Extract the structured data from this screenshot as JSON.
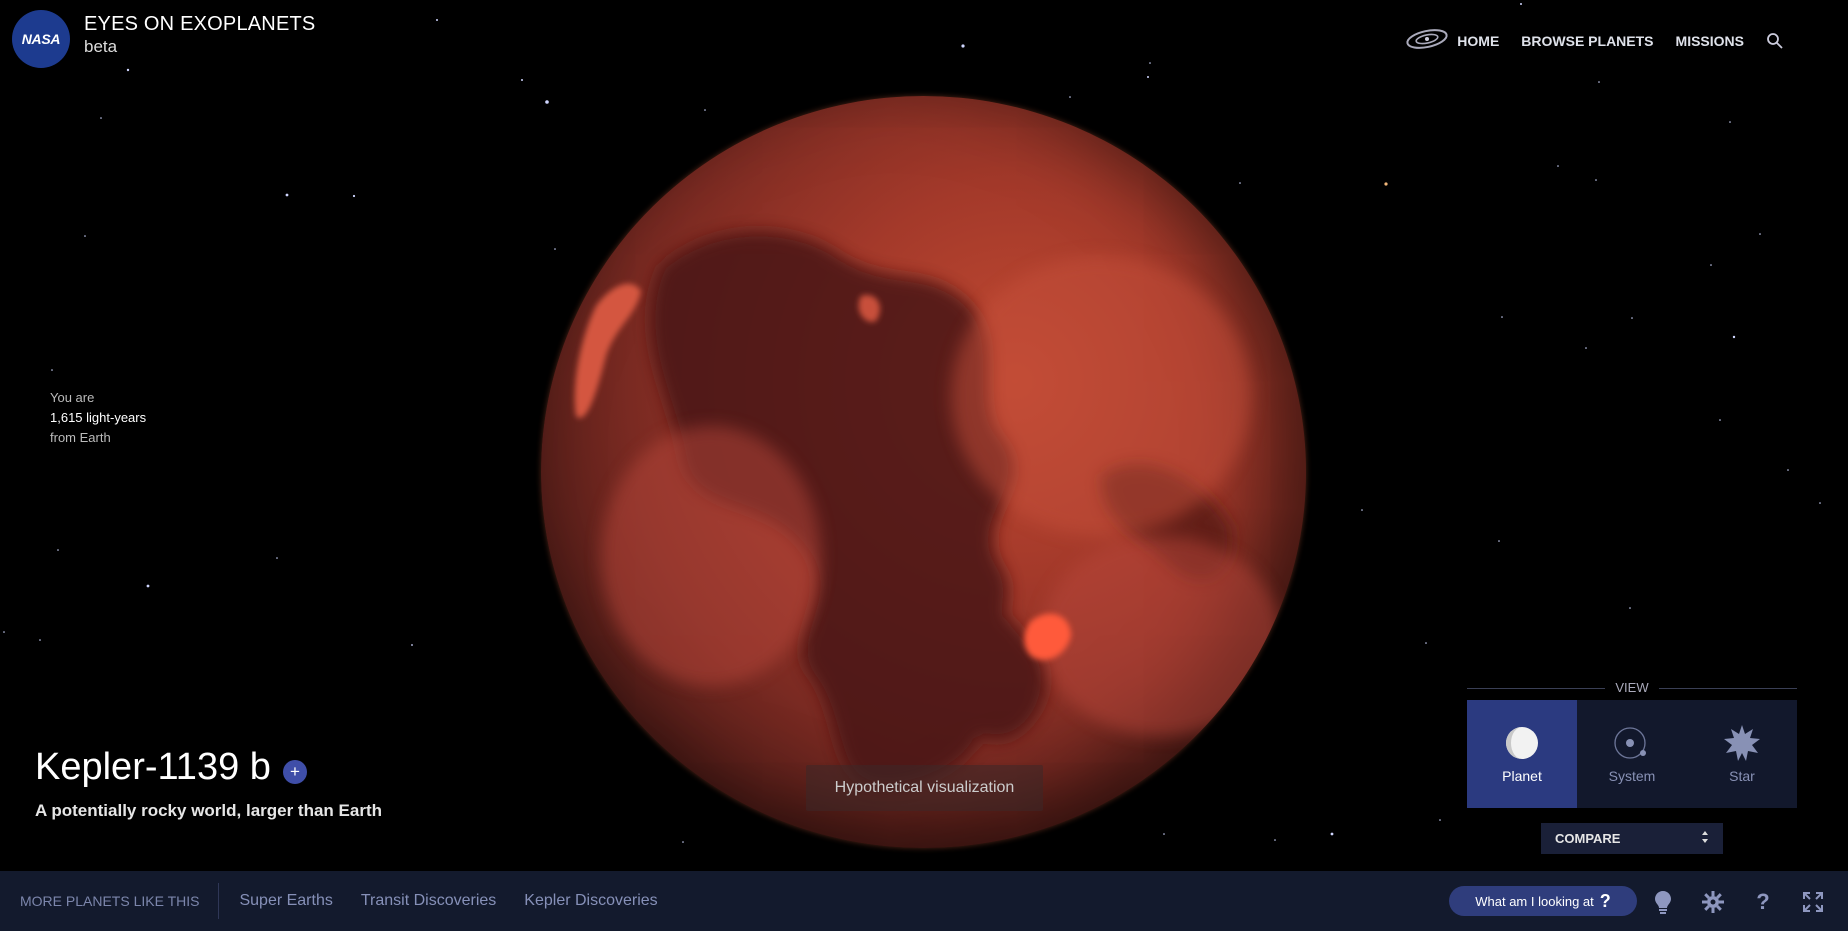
{
  "header": {
    "logo_text": "NASA",
    "title": "EYES ON EXOPLANETS",
    "subtitle": "beta",
    "nav": {
      "home": "HOME",
      "browse": "BROWSE PLANETS",
      "missions": "MISSIONS"
    }
  },
  "distance": {
    "line1": "You are",
    "value": "1,615 light-years",
    "line3": "from Earth"
  },
  "planet": {
    "name": "Kepler-1139 b",
    "description": "A potentially rocky world, larger than Earth",
    "plus_label": "+"
  },
  "visualization_note": "Hypothetical visualization",
  "view": {
    "label": "VIEW",
    "options": [
      "Planet",
      "System",
      "Star"
    ],
    "selected": "Planet"
  },
  "compare": {
    "label": "COMPARE"
  },
  "footer": {
    "more_label": "MORE PLANETS LIKE THIS",
    "links": [
      "Super Earths",
      "Transit Discoveries",
      "Kepler Discoveries"
    ],
    "help_button": "What am I looking at",
    "help_symbol": "?"
  },
  "icons": [
    "nasa-logo",
    "galaxy-icon",
    "search-icon",
    "plus-icon",
    "planet-view-icon",
    "system-view-icon",
    "star-view-icon",
    "sort-arrows-icon",
    "lightbulb-icon",
    "gear-icon",
    "help-icon",
    "fullscreen-icon"
  ],
  "colors": {
    "background": "#000000",
    "planet": "#a3392a",
    "accent": "#2b3a80",
    "footer": "#131a2d"
  }
}
